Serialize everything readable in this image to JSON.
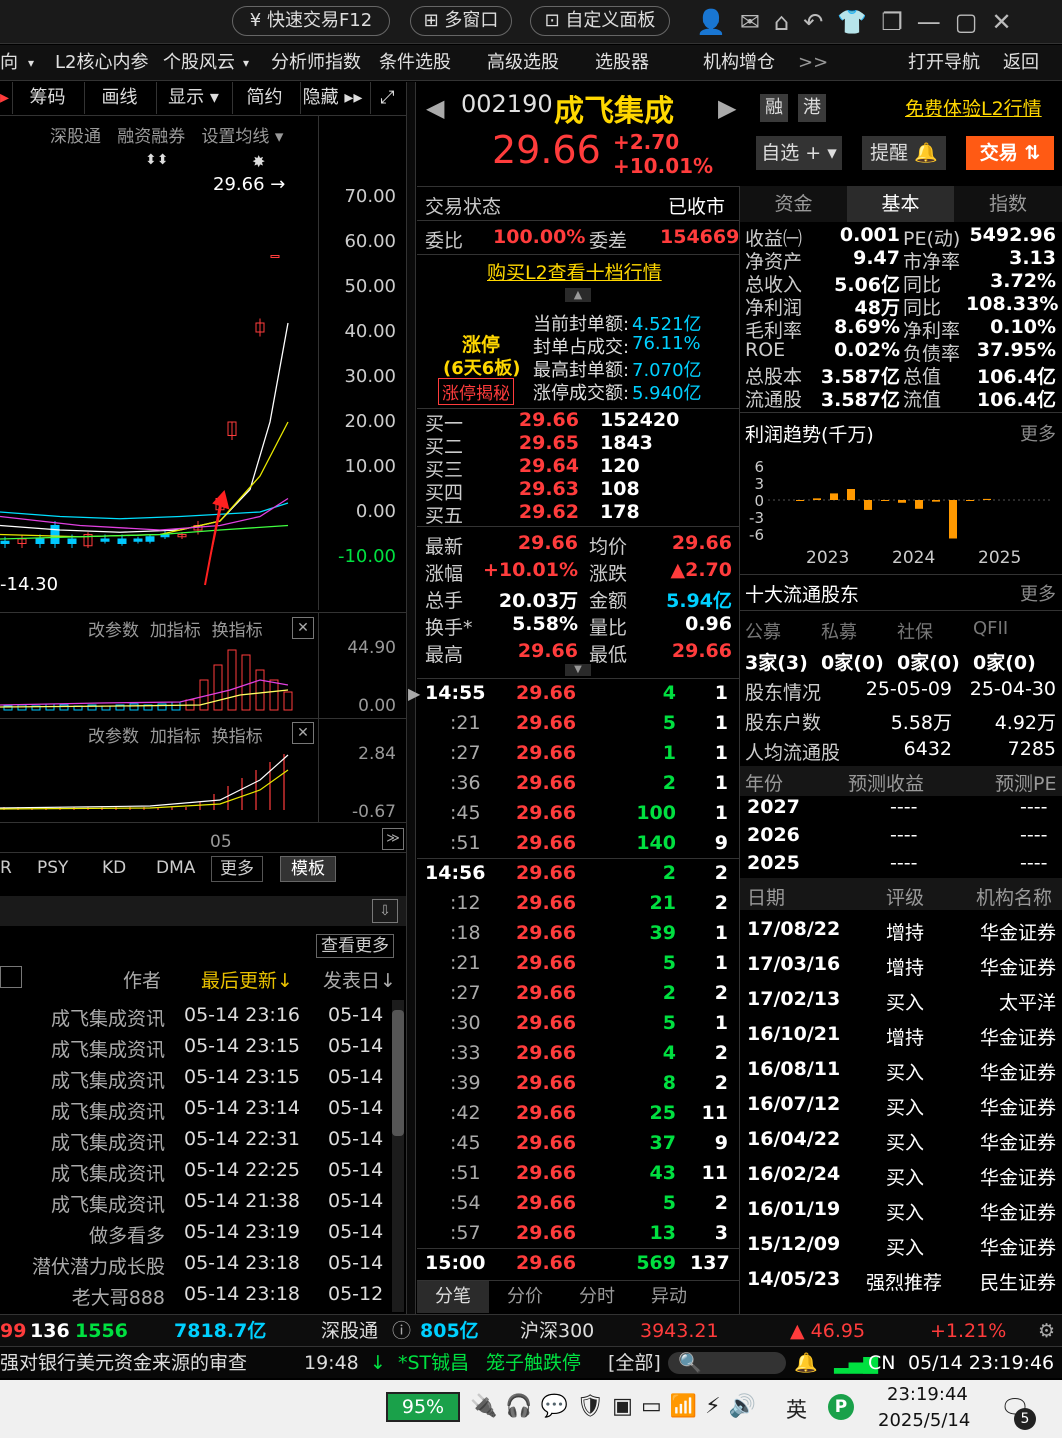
{
  "titlebar": {
    "quick_trade": "快速交易F12",
    "multi_window": "多窗口",
    "custom_board": "自定义面板"
  },
  "menu": {
    "items": [
      "向",
      "L2核心内参",
      "个股风云",
      "分析师指数",
      "条件选股",
      "高级选股",
      "选股器",
      "机构增仓",
      ">>"
    ],
    "open_nav": "打开导航",
    "back": "返回"
  },
  "chart_toolbar": {
    "buttons": [
      "筹码",
      "画线",
      "显示",
      "简约",
      "隐藏 ▸▸"
    ],
    "sub": [
      "深股通",
      "融资融券",
      "设置均线"
    ]
  },
  "kline": {
    "last_label": "29.66",
    "low_label": "-14.30",
    "yaxis": [
      "70.00",
      "60.00",
      "50.00",
      "40.00",
      "30.00",
      "20.00",
      "10.00",
      "0.00",
      "-10.00"
    ]
  },
  "indicator1": {
    "btns": [
      "改参数",
      "加指标",
      "换指标"
    ],
    "y": [
      "44.90",
      "0.00"
    ]
  },
  "indicator2": {
    "btns": [
      "改参数",
      "加指标",
      "换指标"
    ],
    "y": [
      "2.84",
      "-0.67"
    ],
    "xlabel": "05"
  },
  "indicator_tabs": [
    "R",
    "PSY",
    "KD",
    "DMA",
    "更多",
    "模板"
  ],
  "news": {
    "more": "查看更多",
    "cols": [
      "作者",
      "最后更新↓",
      "发表日↓"
    ],
    "rows": [
      [
        "成飞集成资讯",
        "05-14 23:16",
        "05-14"
      ],
      [
        "成飞集成资讯",
        "05-14 23:15",
        "05-14"
      ],
      [
        "成飞集成资讯",
        "05-14 23:15",
        "05-14"
      ],
      [
        "成飞集成资讯",
        "05-14 23:14",
        "05-14"
      ],
      [
        "成飞集成资讯",
        "05-14 22:31",
        "05-14"
      ],
      [
        "成飞集成资讯",
        "05-14 22:25",
        "05-14"
      ],
      [
        "成飞集成资讯",
        "05-14 21:38",
        "05-14"
      ],
      [
        "做多看多",
        "05-14 23:19",
        "05-14"
      ],
      [
        "潜伏潜力成长股",
        "05-14 23:18",
        "05-14"
      ],
      [
        "老大哥888",
        "05-14 23:18",
        "05-12"
      ]
    ]
  },
  "stock": {
    "code": "002190",
    "name": "成飞集成",
    "price": "29.66",
    "change": "+2.70",
    "pct": "+10.01%",
    "badges": [
      "融",
      "港"
    ],
    "l2_link": "免费体验L2行情",
    "btn_watch": "自选 +",
    "btn_alert": "提醒",
    "btn_trade": "交易"
  },
  "trade_state": {
    "label": "交易状态",
    "value": "已收市",
    "wb_label": "委比",
    "wb": "100.00%",
    "wc_label": "委差",
    "wc": "154669",
    "buy_l2": "购买L2查看十档行情"
  },
  "limit": {
    "title": "涨停",
    "sub": "(6天6板)",
    "reveal": "涨停揭秘",
    "lines": [
      [
        "当前封单额:",
        "4.521亿"
      ],
      [
        "封单占成交:",
        "76.11%"
      ],
      [
        "最高封单额:",
        "7.070亿"
      ],
      [
        "涨停成交额:",
        "5.940亿"
      ]
    ]
  },
  "bids": [
    [
      "买一",
      "29.66",
      "152420"
    ],
    [
      "买二",
      "29.65",
      "1843"
    ],
    [
      "买三",
      "29.64",
      "120"
    ],
    [
      "买四",
      "29.63",
      "108"
    ],
    [
      "买五",
      "29.62",
      "178"
    ]
  ],
  "quote": [
    [
      "最新",
      "29.66",
      "均价",
      "29.66"
    ],
    [
      "涨幅",
      "+10.01%",
      "涨跌",
      "▲2.70"
    ],
    [
      "总手",
      "20.03万",
      "金额",
      "5.94亿"
    ],
    [
      "换手*",
      "5.58%",
      "量比",
      "0.96"
    ],
    [
      "最高",
      "29.66",
      "最低",
      "29.66"
    ]
  ],
  "ticks": [
    [
      "14:55",
      "29.66",
      "4",
      "1"
    ],
    [
      ":21",
      "29.66",
      "5",
      "1"
    ],
    [
      ":27",
      "29.66",
      "1",
      "1"
    ],
    [
      ":36",
      "29.66",
      "2",
      "1"
    ],
    [
      ":45",
      "29.66",
      "100",
      "1"
    ],
    [
      ":51",
      "29.66",
      "140",
      "9"
    ],
    [
      "14:56",
      "29.66",
      "2",
      "2"
    ],
    [
      ":12",
      "29.66",
      "21",
      "2"
    ],
    [
      ":18",
      "29.66",
      "39",
      "1"
    ],
    [
      ":21",
      "29.66",
      "5",
      "1"
    ],
    [
      ":27",
      "29.66",
      "2",
      "2"
    ],
    [
      ":30",
      "29.66",
      "5",
      "1"
    ],
    [
      ":33",
      "29.66",
      "4",
      "2"
    ],
    [
      ":39",
      "29.66",
      "8",
      "2"
    ],
    [
      ":42",
      "29.66",
      "25",
      "11"
    ],
    [
      ":45",
      "29.66",
      "37",
      "9"
    ],
    [
      ":51",
      "29.66",
      "43",
      "11"
    ],
    [
      ":54",
      "29.66",
      "5",
      "2"
    ],
    [
      ":57",
      "29.66",
      "13",
      "3"
    ],
    [
      "15:00",
      "29.66",
      "569",
      "137"
    ]
  ],
  "tick_tabs": [
    "分笔",
    "分价",
    "分时",
    "异动"
  ],
  "right_tabs": [
    "资金",
    "基本",
    "指数"
  ],
  "fundamentals": [
    [
      "收益㈠",
      "0.001",
      "PE(动)",
      "5492.96"
    ],
    [
      "净资产",
      "9.47",
      "市净率",
      "3.13"
    ],
    [
      "总收入",
      "5.06亿",
      "同比",
      "3.72%"
    ],
    [
      "净利润",
      "48万",
      "同比",
      "108.33%"
    ],
    [
      "毛利率",
      "8.69%",
      "净利率",
      "0.10%"
    ],
    [
      "ROE",
      "0.02%",
      "负债率",
      "37.95%"
    ],
    [
      "总股本",
      "3.587亿",
      "总值",
      "106.4亿"
    ],
    [
      "流通股",
      "3.587亿",
      "流值",
      "106.4亿"
    ]
  ],
  "profit": {
    "title": "利润趋势(千万)",
    "more": "更多",
    "y": [
      "6",
      "3",
      "0",
      "-3",
      "-6"
    ],
    "x": [
      "2023",
      "2024",
      "2025"
    ]
  },
  "holders": {
    "title": "十大流通股东",
    "more": "更多",
    "heads": [
      "公募",
      "私募",
      "社保",
      "QFII"
    ],
    "vals": [
      "3家(3)",
      "0家(0)",
      "0家(0)",
      "0家(0)"
    ],
    "rows": [
      [
        "股东情况",
        "25-05-09",
        "25-04-30"
      ],
      [
        "股东户数",
        "5.58万",
        "4.92万"
      ],
      [
        "人均流通股",
        "6432",
        "7285"
      ]
    ]
  },
  "forecast": {
    "heads": [
      "年份",
      "预测收益",
      "预测PE"
    ],
    "rows": [
      [
        "2027",
        "----",
        "----"
      ],
      [
        "2026",
        "----",
        "----"
      ],
      [
        "2025",
        "----",
        "----"
      ]
    ]
  },
  "ratings": {
    "heads": [
      "日期",
      "评级",
      "机构名称"
    ],
    "rows": [
      [
        "17/08/22",
        "增持",
        "华金证券"
      ],
      [
        "17/03/16",
        "增持",
        "华金证券"
      ],
      [
        "17/02/13",
        "买入",
        "太平洋"
      ],
      [
        "16/10/21",
        "增持",
        "华金证券"
      ],
      [
        "16/08/11",
        "买入",
        "华金证券"
      ],
      [
        "16/07/12",
        "买入",
        "华金证券"
      ],
      [
        "16/04/22",
        "买入",
        "华金证券"
      ],
      [
        "16/02/24",
        "买入",
        "华金证券"
      ],
      [
        "16/01/19",
        "买入",
        "华金证券"
      ],
      [
        "15/12/09",
        "买入",
        "华金证券"
      ],
      [
        "14/05/23",
        "强烈推荐",
        "民生证券"
      ]
    ]
  },
  "statusbar": {
    "a": "99",
    "b": "136",
    "c": "1556",
    "d": "7818.7亿",
    "sgt": "深股通",
    "sgt_val": "805亿",
    "hs": "沪深300",
    "hs_val": "3943.21",
    "hs_chg": "▲ 46.95",
    "hs_pct": "+1.21%"
  },
  "ticker": {
    "news": "强对银行美元资金来源的审查",
    "time": "19:48",
    "stock": "*ST铖昌",
    "event": "笼子触跌停",
    "all": "[全部]",
    "cn": "CN",
    "datetime": "05/14  23:19:46"
  },
  "taskbar": {
    "battery": "95%",
    "ime": "英",
    "time": "23:19:44",
    "date": "2025/5/14",
    "notif": "5"
  }
}
